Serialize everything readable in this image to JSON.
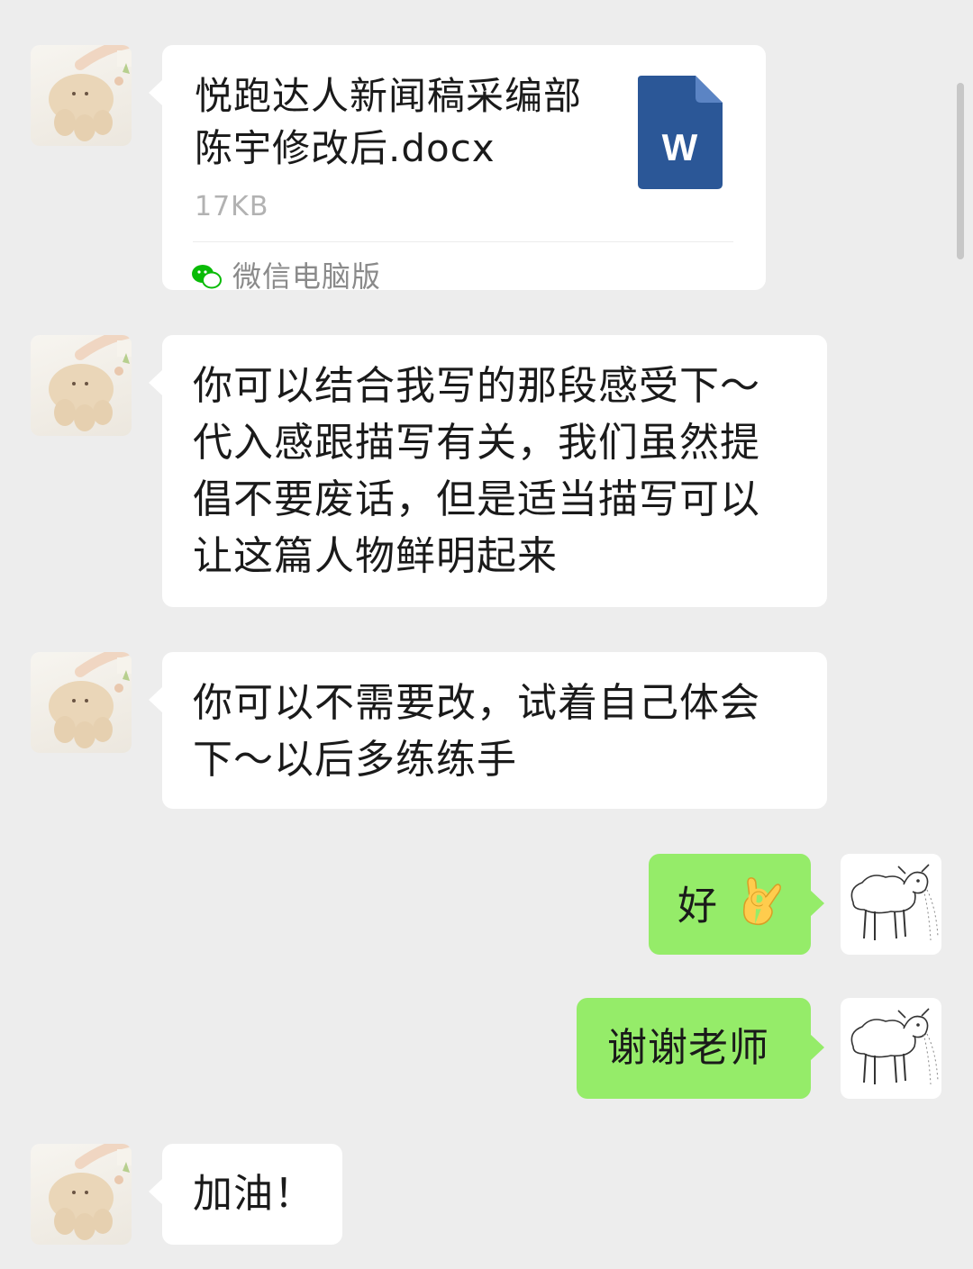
{
  "messages": [
    {
      "type": "file",
      "side": "left",
      "file_name": "悦跑达人新闻稿采编部陈宇修改后.docx",
      "file_size": "17KB",
      "file_icon": "word-file-icon",
      "file_icon_letter": "W",
      "source_icon": "wechat-icon",
      "source_label": "微信电脑版"
    },
    {
      "type": "text",
      "side": "left",
      "text": "你可以结合我写的那段感受下～代入感跟描写有关，我们虽然提倡不要废话，但是适当描写可以让这篇人物鲜明起来"
    },
    {
      "type": "text",
      "side": "left",
      "text": "你可以不需要改，试着自己体会下～以后多练练手"
    },
    {
      "type": "text",
      "side": "right",
      "text": "好",
      "emoji": "ok-hand-emoji"
    },
    {
      "type": "text",
      "side": "right",
      "text": "谢谢老师"
    },
    {
      "type": "text",
      "side": "left",
      "text": "加油！"
    }
  ],
  "avatars": {
    "left": "plush-toy-avatar",
    "right": "lamb-drawing-avatar"
  },
  "colors": {
    "background": "#ededed",
    "bubble_left": "#ffffff",
    "bubble_right": "#95ec69",
    "word_blue": "#2b5797",
    "wechat_green": "#09bb07"
  }
}
